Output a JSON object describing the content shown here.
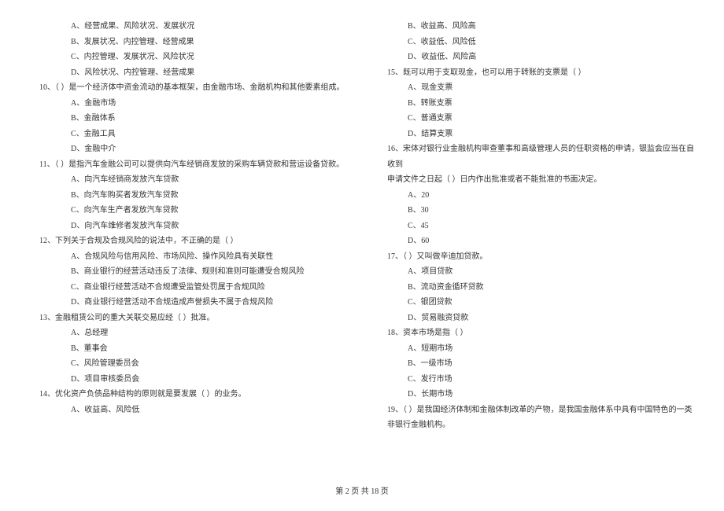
{
  "left": {
    "q9": {
      "opts": {
        "A": "A、经营成果、风险状况、发展状况",
        "B": "B、发展状况、内控管理、经营成果",
        "C": "C、内控管理、发展状况、风险状况",
        "D": "D、风险状况、内控管理、经营成果"
      }
    },
    "q10": {
      "stem": "10、（    ）是一个经济体中资金流动的基本框架，由金融市场、金融机构和其他要素组成。",
      "opts": {
        "A": "A、金融市场",
        "B": "B、金融体系",
        "C": "C、金融工具",
        "D": "D、金融中介"
      }
    },
    "q11": {
      "stem": "11、（    ）是指汽车金融公司可以提供向汽车经销商发放的采购车辆贷款和营运设备贷款。",
      "opts": {
        "A": "A、向汽车经销商发放汽车贷款",
        "B": "B、向汽车购买者发放汽车贷款",
        "C": "C、向汽车生产者发放汽车贷款",
        "D": "D、向汽车维修者发放汽车贷款"
      }
    },
    "q12": {
      "stem": "12、下列关于合规及合规风险的说法中，不正确的是（    ）",
      "opts": {
        "A": "A、合规风险与信用风险、市场风险、操作风险具有关联性",
        "B": "B、商业银行的经营活动违反了法律、规则和准则可能遭受合规风险",
        "C": "C、商业银行经营活动不合规遭受监管处罚属于合规风险",
        "D": "D、商业银行经营活动不合规造成声誉损失不属于合规风险"
      }
    },
    "q13": {
      "stem": "13、金融租赁公司的重大关联交易应经（    ）批准。",
      "opts": {
        "A": "A、总经理",
        "B": "B、董事会",
        "C": "C、风险管理委员会",
        "D": "D、项目审核委员会"
      }
    },
    "q14": {
      "stem": "14、优化资产负债品种结构的原则就是要发展（    ）的业务。",
      "opts": {
        "A": "A、收益高、风险低"
      }
    }
  },
  "right": {
    "q14": {
      "opts": {
        "B": "B、收益高、风险高",
        "C": "C、收益低、风险低",
        "D": "D、收益低、风险高"
      }
    },
    "q15": {
      "stem": "15、既可以用于支取现金，也可以用于转账的支票是（    ）",
      "opts": {
        "A": "A、现金支票",
        "B": "B、转账支票",
        "C": "C、普通支票",
        "D": "D、结算支票"
      }
    },
    "q16": {
      "stem1": "16、宋体对银行业金融机构审查董事和高级管理人员的任职资格的申请，银监会应当在自收到",
      "stem2": "申请文件之日起（    ）日内作出批准或者不能批准的书面决定。",
      "opts": {
        "A": "A、20",
        "B": "B、30",
        "C": "C、45",
        "D": "D、60"
      }
    },
    "q17": {
      "stem": "17、（    ）又叫做辛迪加贷款。",
      "opts": {
        "A": "A、项目贷款",
        "B": "B、流动资金循环贷款",
        "C": "C、银团贷款",
        "D": "D、贸易融资贷款"
      }
    },
    "q18": {
      "stem": "18、资本市场是指（    ）",
      "opts": {
        "A": "A、短期市场",
        "B": "B、一级市场",
        "C": "C、发行市场",
        "D": "D、长期市场"
      }
    },
    "q19": {
      "stem1": "19、（    ）是我国经济体制和金融体制改革的产物，是我国金融体系中具有中国特色的一类",
      "stem2": "非银行金融机构。"
    }
  },
  "footer": "第 2 页 共 18 页"
}
